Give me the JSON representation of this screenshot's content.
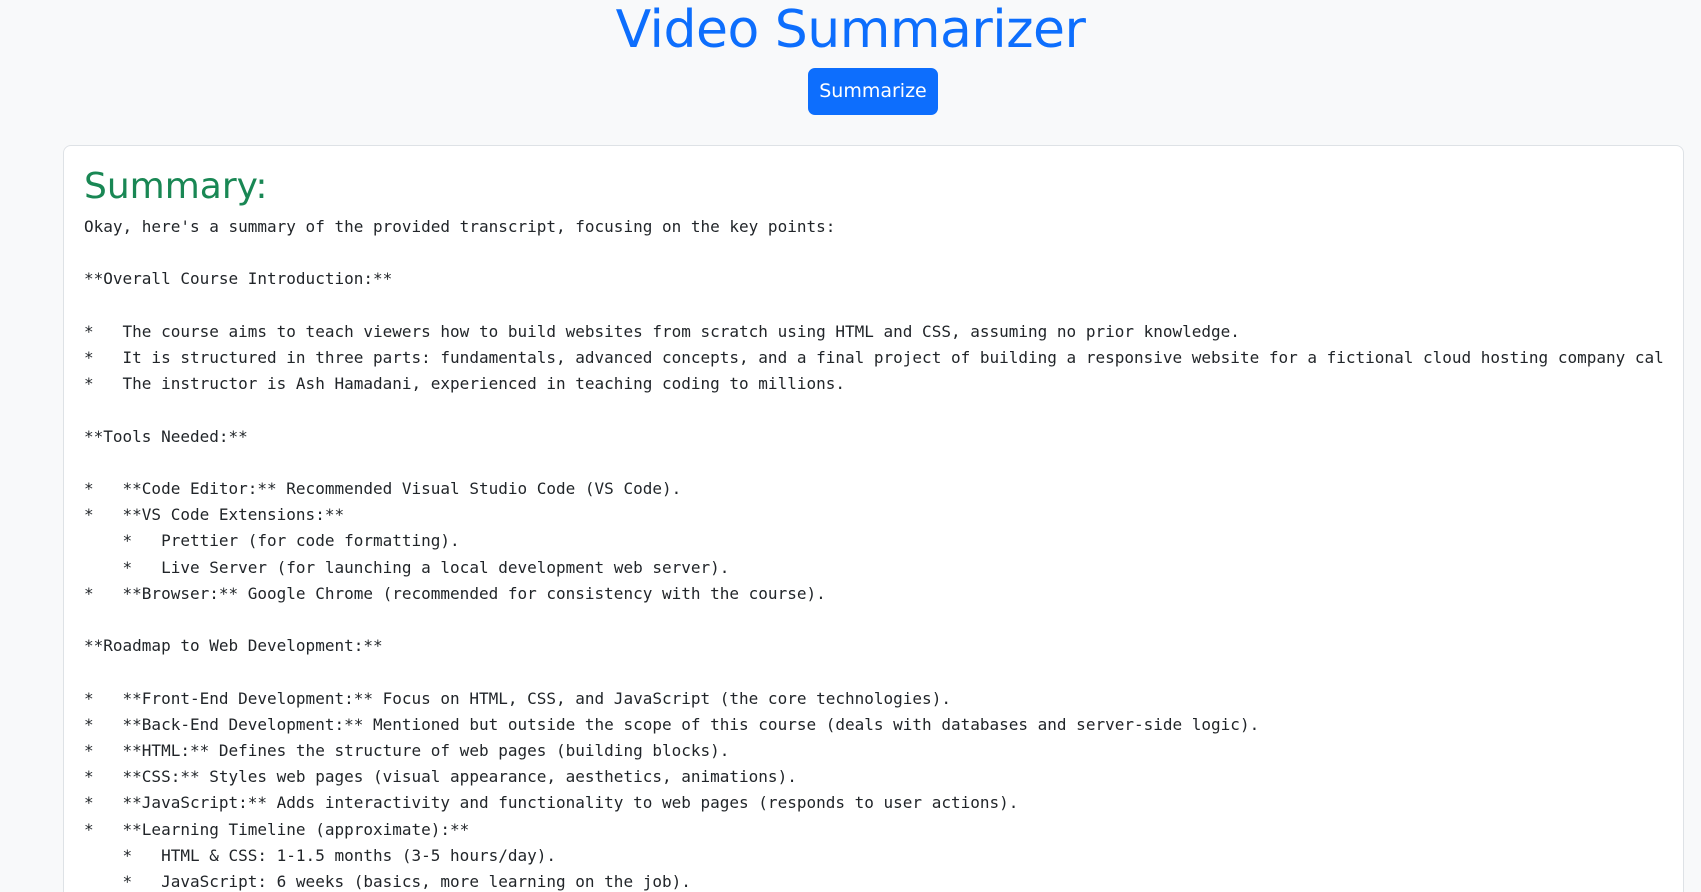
{
  "header": {
    "title": "Video Summarizer",
    "summarize_label": "Summarize"
  },
  "summary": {
    "heading": "Summary:",
    "text": "Okay, here's a summary of the provided transcript, focusing on the key points:\n\n**Overall Course Introduction:**\n\n*   The course aims to teach viewers how to build websites from scratch using HTML and CSS, assuming no prior knowledge.\n*   It is structured in three parts: fundamentals, advanced concepts, and a final project of building a responsive website for a fictional cloud hosting company cal\n*   The instructor is Ash Hamadani, experienced in teaching coding to millions.\n\n**Tools Needed:**\n\n*   **Code Editor:** Recommended Visual Studio Code (VS Code).\n*   **VS Code Extensions:**\n    *   Prettier (for code formatting).\n    *   Live Server (for launching a local development web server).\n*   **Browser:** Google Chrome (recommended for consistency with the course).\n\n**Roadmap to Web Development:**\n\n*   **Front-End Development:** Focus on HTML, CSS, and JavaScript (the core technologies).\n*   **Back-End Development:** Mentioned but outside the scope of this course (deals with databases and server-side logic).\n*   **HTML:** Defines the structure of web pages (building blocks).\n*   **CSS:** Styles web pages (visual appearance, aesthetics, animations).\n*   **JavaScript:** Adds interactivity and functionality to web pages (responds to user actions).\n*   **Learning Timeline (approximate):**\n    *   HTML & CSS: 1-1.5 months (3-5 hours/day).\n    *   JavaScript: 6 weeks (basics, more learning on the job)."
  },
  "colors": {
    "primary": "#0d6efd",
    "success": "#198754",
    "page_background": "#f8f9fa",
    "card_border": "#dee2e6"
  }
}
